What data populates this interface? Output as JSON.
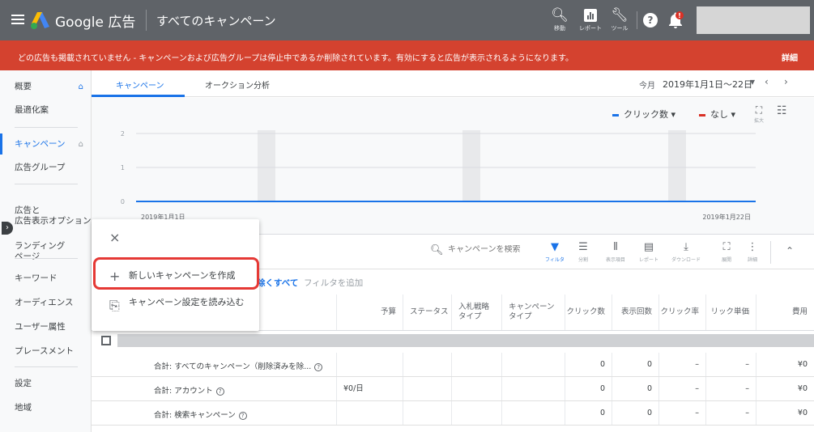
{
  "header": {
    "brand": "Google 広告",
    "title": "すべてのキャンペーン",
    "tools": [
      {
        "icon": "search-icon",
        "label": "移動"
      },
      {
        "icon": "report-icon",
        "label": "レポート"
      },
      {
        "icon": "wrench-icon",
        "label": "ツール"
      }
    ],
    "help": "?",
    "notification_badge": "!"
  },
  "alert": {
    "text": "どの広告も掲載されていません - キャンペーンおよび広告グループは停止中であるか削除されています。有効にすると広告が表示されるようになります。",
    "link": "詳細",
    "color": "#d4422f"
  },
  "sidebar": {
    "items": [
      {
        "label": "概要"
      },
      {
        "label": "最適化案"
      },
      {
        "label": "キャンペーン"
      },
      {
        "label": "広告グループ"
      },
      {
        "label": "広告と\n広告表示オプション"
      },
      {
        "label": "ランディング\nページ"
      },
      {
        "label": "キーワード"
      },
      {
        "label": "オーディエンス"
      },
      {
        "label": "ユーザー属性"
      },
      {
        "label": "プレースメント"
      },
      {
        "label": "設定"
      },
      {
        "label": "地域"
      }
    ]
  },
  "tabs": {
    "items": [
      "キャンペーン",
      "オークション分析"
    ],
    "date_prefix": "今月",
    "date_range": "2019年1月1日～22日"
  },
  "chart": {
    "metric1": "クリック数",
    "metric2": "なし",
    "metric1_color": "#1a73e8",
    "metric2_color": "#d93025",
    "expand_label": "拡大"
  },
  "chart_data": {
    "type": "line",
    "x": [
      "2019年1月1日",
      "2019年1月22日"
    ],
    "series": [
      {
        "name": "クリック数",
        "values": [
          0,
          0
        ]
      }
    ],
    "ylim": [
      0,
      2
    ],
    "yticks": [
      "0",
      "1",
      "2"
    ],
    "xtick_labels": [
      "2019年1月1日",
      "2019年1月22日"
    ],
    "grid": true
  },
  "toolbar": {
    "search_placeholder": "キャンペーンを検索",
    "tools": [
      {
        "icon": "filter-icon",
        "label": "フィルタ"
      },
      {
        "icon": "segment-icon",
        "label": "分割"
      },
      {
        "icon": "columns-icon",
        "label": "表示項目"
      },
      {
        "icon": "report-icon",
        "label": "レポート"
      },
      {
        "icon": "download-icon",
        "label": "ダウンロード"
      },
      {
        "icon": "expand-icon",
        "label": "展開"
      },
      {
        "icon": "more-icon",
        "label": "詳細"
      }
    ]
  },
  "filters": {
    "clear": "除くすべて",
    "add": "フィルタを追加"
  },
  "popup": {
    "close": "×",
    "create_label": "新しいキャンペーンを作成",
    "load_label": "キャンペーン設定を読み込む"
  },
  "table": {
    "columns": [
      "予算",
      "ステータス",
      "入札戦略\nタイプ",
      "キャンペーン\nタイプ",
      "クリック数",
      "表示回数",
      "クリック率",
      "リック単価",
      "費用"
    ],
    "rows": [
      {
        "name": "合計: すべてのキャンペーン（削除済みを除...",
        "budget": "",
        "clicks": "0",
        "impressions": "0",
        "ctr": "–",
        "cpc": "–",
        "cost": "¥0",
        "help": true
      },
      {
        "name": "合計: アカウント",
        "budget": "¥0/日",
        "clicks": "0",
        "impressions": "0",
        "ctr": "–",
        "cpc": "–",
        "cost": "¥0",
        "help": true
      },
      {
        "name": "合計: 検索キャンペーン",
        "budget": "",
        "clicks": "0",
        "impressions": "0",
        "ctr": "–",
        "cpc": "–",
        "cost": "¥0",
        "help": true
      }
    ]
  }
}
